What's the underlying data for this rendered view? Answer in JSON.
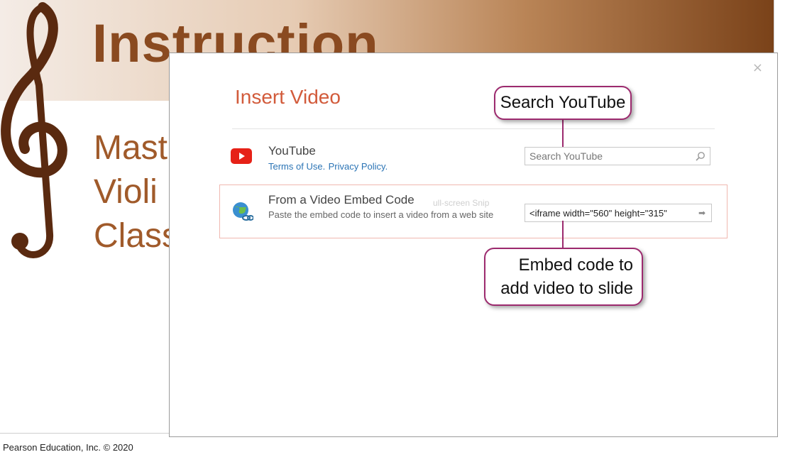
{
  "slide": {
    "title": "Instruction",
    "subtitle_lines": [
      "Mast",
      "Violi",
      "Class"
    ]
  },
  "dialog": {
    "title": "Insert Video",
    "close_glyph": "×",
    "youtube": {
      "icon": "youtube-play-icon",
      "title": "YouTube",
      "terms_link": "Terms of Use.",
      "privacy_link": "Privacy Policy.",
      "search_placeholder": "Search YouTube",
      "search_icon": "magnifier-icon"
    },
    "embed": {
      "icon": "globe-link-icon",
      "title": "From a Video Embed Code",
      "description": "Paste the embed code to insert a video from a web site",
      "ghost_text": "ull-screen Snip",
      "input_value": "<iframe width=\"560\" height=\"315\"",
      "arrow_glyph": "➡"
    }
  },
  "callouts": {
    "search": "Search YouTube",
    "embed_line1": "Embed code to",
    "embed_line2": "add video to slide"
  },
  "footer": "Pearson Education, Inc. © 2020",
  "colors": {
    "accent_title": "#d25b3b",
    "link": "#2b74b5",
    "callout_border": "#9c2a6e",
    "slide_brown": "#8a4a20"
  }
}
